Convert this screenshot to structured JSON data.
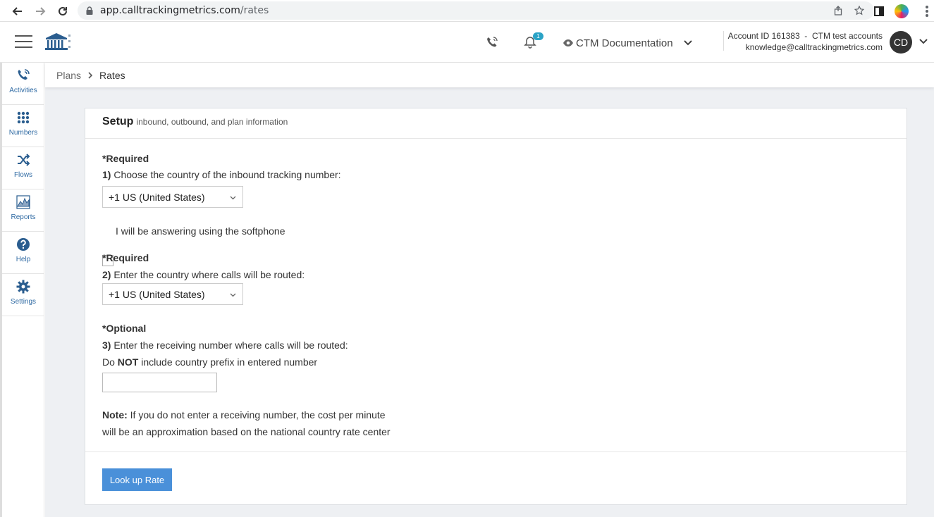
{
  "browser": {
    "url_host": "app.calltrackingmetrics.com",
    "url_path": "/rates"
  },
  "header": {
    "notification_count": "1",
    "doc_switch_label": "CTM Documentation",
    "account_line": "Account ID 161383  -  CTM test accounts",
    "email": "knowledge@calltrackingmetrics.com",
    "avatar_initials": "CD"
  },
  "sidebar": {
    "items": [
      {
        "label": "Activities",
        "icon": "phone-activity-icon"
      },
      {
        "label": "Numbers",
        "icon": "grid-icon"
      },
      {
        "label": "Flows",
        "icon": "shuffle-icon"
      },
      {
        "label": "Reports",
        "icon": "chart-icon"
      },
      {
        "label": "Help",
        "icon": "question-icon"
      },
      {
        "label": "Settings",
        "icon": "gear-icon"
      }
    ]
  },
  "breadcrumb": {
    "parent": "Plans",
    "current": "Rates"
  },
  "panel": {
    "title": "Setup",
    "subtitle": "inbound, outbound, and plan information",
    "section1": {
      "required": "*Required",
      "num": "1)",
      "label": "Choose the country of the inbound tracking number:",
      "select_value": "+1 US (United States)"
    },
    "softphone_label": "I will be answering using the softphone",
    "section2": {
      "required": "*Required",
      "num": "2)",
      "label": "Enter the country where calls will be routed:",
      "select_value": "+1 US (United States)"
    },
    "section3": {
      "optional": "*Optional",
      "num": "3)",
      "label": "Enter the receiving number where calls will be routed:",
      "hint_pre": "Do",
      "hint_bold": "NOT",
      "hint_post": "include country prefix in entered number",
      "input_value": ""
    },
    "note": {
      "label": "Note:",
      "line1": "If you do not enter a receiving number, the cost per minute",
      "line2": "will be an approximation based on the national country rate center"
    },
    "button_label": "Look up Rate"
  },
  "colors": {
    "accent": "#4a90d9",
    "sidebar_label": "#2f6aa3",
    "badge": "#2ba3c6"
  }
}
